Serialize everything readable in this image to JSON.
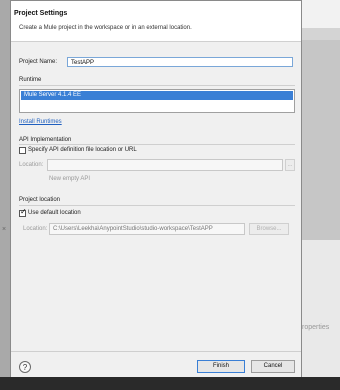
{
  "dialog": {
    "title": "Project Settings",
    "subtitle": "Create a Mule project in the workspace or in an external location."
  },
  "project": {
    "name_label": "Project Name:",
    "name_value": "TestAPP"
  },
  "runtime": {
    "group_label": "Runtime",
    "selected_item": "Mule Server 4.1.4 EE",
    "install_link": "Install Runtimes"
  },
  "api": {
    "group_label": "API Implementation",
    "checkbox_label": "Specify API definition file location or URL",
    "location_label": "Location:",
    "location_value": "",
    "browse_label": "...",
    "new_api_hint": "New empty API"
  },
  "project_location": {
    "group_label": "Project location",
    "checkbox_label": "Use default location",
    "location_label": "Location:",
    "location_value": "C:\\Users\\Leekha\\AnypointStudio\\studio-workspace\\TestAPP",
    "browse_label": "Browse..."
  },
  "footer": {
    "help_label": "?",
    "finish_label": "Finish",
    "cancel_label": "Cancel"
  },
  "background": {
    "side_text": "roperties",
    "close_glyph": "×"
  }
}
